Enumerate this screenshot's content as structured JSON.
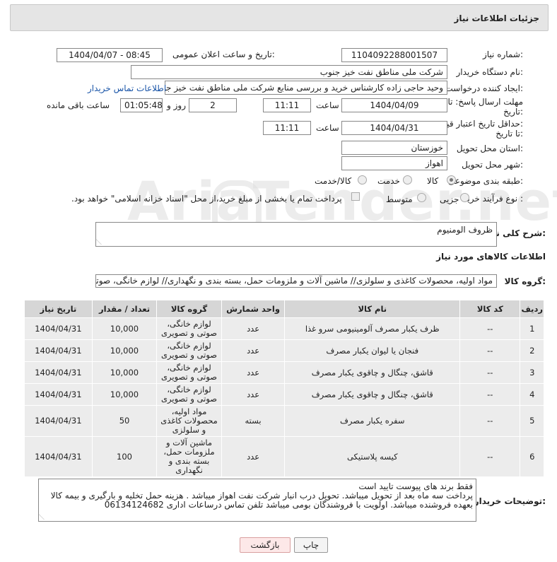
{
  "header": {
    "title": "جزئیات اطلاعات نیاز"
  },
  "watermark": "AriaTender.net",
  "form": {
    "need_number_label": "شماره نیاز:",
    "need_number": "1104092288001507",
    "announce_label": "تاریخ و ساعت اعلان عمومی:",
    "announce_value": "1404/04/07 - 08:45",
    "buyer_org_label": "نام دستگاه خریدار:",
    "buyer_org": "شرکت ملی مناطق نفت خیز جنوب",
    "creator_label": "ایجاد کننده درخواست:",
    "creator": "وحید حاجی زاده  کارشناس خرید و بررسی منابع  شرکت ملی مناطق نفت خیز جنوب",
    "contact_link": "اطلاعات تماس خریدار",
    "deadline_label_1": "مهلت ارسال پاسخ: تا",
    "deadline_label_2": "تاریخ:",
    "deadline_date": "1404/04/09",
    "time_label": "ساعت",
    "deadline_time": "11:11",
    "days_value": "2",
    "days_label": "روز و",
    "remaining_value": "01:05:48",
    "remaining_label": "ساعت باقی مانده",
    "validity_label_1": "حداقل تاریخ اعتبار قیمت:",
    "validity_label_2": "تا تاریخ:",
    "validity_date": "1404/04/31",
    "validity_time": "11:11",
    "province_label": "استان محل تحویل:",
    "province": "خوزستان",
    "city_label": "شهر محل تحویل:",
    "city": "اهواز",
    "category_label": "طبقه بندی موضوعی:",
    "category_options": [
      "کالا",
      "خدمت",
      "کالا/خدمت"
    ],
    "category_selected": "کالا",
    "process_label": "نوع فرآیند خرید :",
    "process_options": [
      "جزیی",
      "متوسط"
    ],
    "process_selected": "جزیی",
    "payment_note": "پرداخت تمام یا بخشی از مبلغ خرید،از محل \"اسناد خزانه اسلامی\" خواهد بود."
  },
  "description": {
    "label": "شرح کلی نیاز:",
    "value": "ظروف الومنیوم"
  },
  "goods_section": {
    "title": "اطلاعات کالاهای مورد نیاز"
  },
  "goods_group": {
    "label": "گروه کالا:",
    "value": "مواد اولیه، محصولات کاغذی و سلولزی// ماشین آلات و ملزومات حمل، بسته بندی و نگهداری// لوازم خانگی، صوتی و تصویری"
  },
  "table": {
    "headers": [
      "ردیف",
      "کد کالا",
      "نام کالا",
      "واحد شمارش",
      "گروه کالا",
      "تعداد / مقدار",
      "تاریخ نیاز"
    ],
    "rows": [
      {
        "row": "1",
        "code": "--",
        "name": "ظرف یکبار مصرف آلومینیومی سرو غذا",
        "unit": "عدد",
        "group": "لوازم خانگی، صوتی و تصویری",
        "qty": "10,000",
        "date": "1404/04/31"
      },
      {
        "row": "2",
        "code": "--",
        "name": "فنجان یا لیوان یکبار مصرف",
        "unit": "عدد",
        "group": "لوازم خانگی، صوتی و تصویری",
        "qty": "10,000",
        "date": "1404/04/31"
      },
      {
        "row": "3",
        "code": "--",
        "name": "قاشق، چنگال و چاقوی یکبار مصرف",
        "unit": "عدد",
        "group": "لوازم خانگی، صوتی و تصویری",
        "qty": "10,000",
        "date": "1404/04/31"
      },
      {
        "row": "4",
        "code": "--",
        "name": "قاشق، چنگال و چاقوی یکبار مصرف",
        "unit": "عدد",
        "group": "لوازم خانگی، صوتی و تصویری",
        "qty": "10,000",
        "date": "1404/04/31"
      },
      {
        "row": "5",
        "code": "--",
        "name": "سفره یکبار مصرف",
        "unit": "بسته",
        "group": "مواد اولیه، محصولات کاغذی و سلولزی",
        "qty": "50",
        "date": "1404/04/31"
      },
      {
        "row": "6",
        "code": "--",
        "name": "کیسه پلاستیکی",
        "unit": "عدد",
        "group": "ماشین آلات و ملزومات حمل، بسته بندی و نگهداری",
        "qty": "100",
        "date": "1404/04/31"
      }
    ]
  },
  "buyer_notes": {
    "label": "توضیحات خریدار:",
    "lines": [
      "فقط برند های پیوست تایید است",
      "پرداخت سه ماه بعد از تحویل میباشد.   تحویل درب انبار شرکت نفت اهواز میباشد .  هزینه حمل تخلیه و بارگیری و بیمه کالا",
      "بعهده فروشنده میباشد.  اولویت با فروشندگان بومی میباشد  تلفن تماس درساعات اداری 06134124682"
    ]
  },
  "buttons": {
    "print": "چاپ",
    "back": "بازگشت"
  }
}
